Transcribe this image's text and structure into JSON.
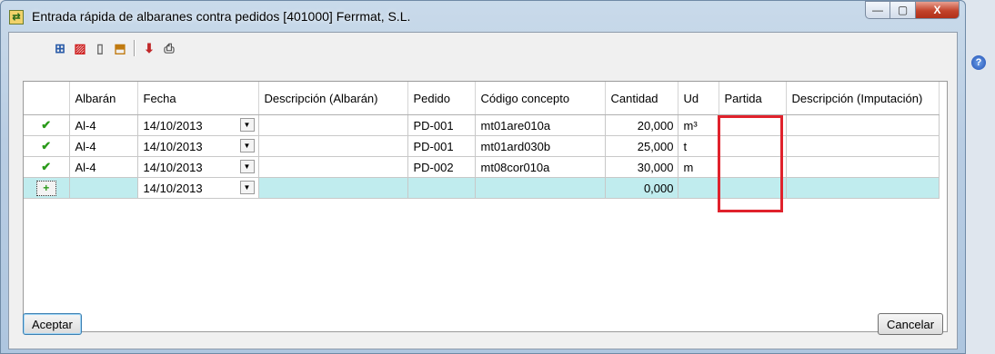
{
  "window": {
    "title": "Entrada rápida de albaranes contra pedidos [401000] Ferrmat, S.L.",
    "controls": {
      "minimize": "—",
      "maximize": "▢",
      "close": "X"
    }
  },
  "toolbar": {
    "icons": [
      "add-row-icon",
      "delete-row-icon",
      "copy-icon",
      "import-icon",
      "export-icon",
      "print-icon"
    ]
  },
  "help": {
    "label": "?"
  },
  "grid": {
    "columns": [
      "",
      "Albarán",
      "Fecha",
      "Descripción (Albarán)",
      "Pedido",
      "Código concepto",
      "Cantidad",
      "Ud",
      "Partida",
      "Descripción (Imputación)"
    ],
    "rows": [
      {
        "status": "✔",
        "albaran": "Al-4",
        "fecha": "14/10/2013",
        "desc_albaran": "",
        "pedido": "PD-001",
        "codigo": "mt01are010a",
        "cantidad": "20,000",
        "ud": "m³",
        "partida": "",
        "desc_imputacion": ""
      },
      {
        "status": "✔",
        "albaran": "Al-4",
        "fecha": "14/10/2013",
        "desc_albaran": "",
        "pedido": "PD-001",
        "codigo": "mt01ard030b",
        "cantidad": "25,000",
        "ud": "t",
        "partida": "",
        "desc_imputacion": ""
      },
      {
        "status": "✔",
        "albaran": "Al-4",
        "fecha": "14/10/2013",
        "desc_albaran": "",
        "pedido": "PD-002",
        "codigo": "mt08cor010a",
        "cantidad": "30,000",
        "ud": "m",
        "partida": "",
        "desc_imputacion": ""
      }
    ],
    "new_row": {
      "status": "+",
      "fecha": "14/10/2013",
      "cantidad": "0,000"
    }
  },
  "buttons": {
    "accept": "Aceptar",
    "cancel": "Cancelar"
  },
  "colors": {
    "highlight": "#e0222c",
    "new_row": "#c0ecee",
    "check": "#2a9a1a"
  }
}
